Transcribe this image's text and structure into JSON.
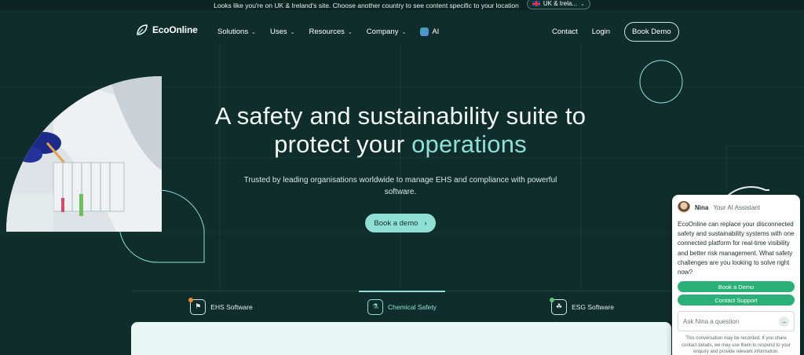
{
  "topbar": {
    "message": "Looks like you're on UK & Ireland's site. Choose another country to see content specific to your location",
    "country": "UK & Irela..."
  },
  "nav": {
    "logo": "EcoOnline",
    "menu": [
      "Solutions",
      "Uses",
      "Resources",
      "Company"
    ],
    "ai_label": "AI",
    "contact": "Contact",
    "login": "Login",
    "book_demo": "Book Demo"
  },
  "hero": {
    "title_line1": "A safety and sustainability suite to",
    "title_line2_prefix": "protect your",
    "title_accent": "operations",
    "subtitle": "Trusted by leading organisations worldwide to manage EHS and compliance with powerful software.",
    "cta": "Book a demo"
  },
  "tabs": [
    {
      "label": "EHS Software",
      "icon": "hardhat-icon"
    },
    {
      "label": "Chemical Safety",
      "icon": "flask-icon"
    },
    {
      "label": "ESG Software",
      "icon": "leaf-icon"
    }
  ],
  "chat": {
    "name": "Nina",
    "role": "Your AI Assistant",
    "message": "EcoOnline can replace your disconnected safety and sustainability systems with one connected platform for real-time visibility and better risk management. What safety challenges are you looking to solve right now?",
    "btn_demo": "Book a Demo",
    "btn_support": "Contact Support",
    "input_placeholder": "Ask Nina a question",
    "note": "This conversation may be recorded. If you share contact details, we may use them to respond to your enquiry and provide relevant information."
  },
  "colors": {
    "background": "#0f2e2b",
    "accent": "#8fe0d4",
    "chat_button": "#2bb07a"
  }
}
